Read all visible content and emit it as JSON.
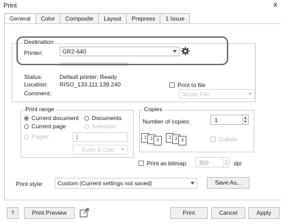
{
  "window": {
    "title": "Print",
    "close_glyph": "x"
  },
  "tabs": [
    {
      "label": "General",
      "active": true
    },
    {
      "label": "Color",
      "active": false
    },
    {
      "label": "Composite",
      "active": false
    },
    {
      "label": "Layout",
      "active": false
    },
    {
      "label": "Prepress",
      "active": false
    },
    {
      "label": "1 Issue",
      "active": false
    }
  ],
  "destination": {
    "label": "Destination",
    "printer_label": "Printer:",
    "printer_value": "GR2-640",
    "status_label": "Status:",
    "status_value": "Default printer; Ready",
    "location_label": "Location:",
    "location_value": "RISO_133.111.139.240",
    "comment_label": "Comment:",
    "print_to_file_label": "Print to file",
    "file_mode_value": "Single File",
    "settings_icon": "gear-icon"
  },
  "print_range": {
    "label": "Print range",
    "current_document": "Current document",
    "documents": "Documents",
    "current_page": "Current page",
    "selection": "Selection",
    "pages": "Pages:",
    "pages_value": "1",
    "pages_filter": "Even & Odd"
  },
  "copies": {
    "label": "Copies",
    "number_label": "Number of copies:",
    "number_value": "1",
    "collate_label": "Collate",
    "collate_pages": [
      "1",
      "2",
      "3",
      "1",
      "2",
      "3"
    ]
  },
  "bitmap": {
    "label": "Print as bitmap:",
    "value": "300",
    "unit": "dpi"
  },
  "print_style": {
    "label": "Print style:",
    "value": "Custom (Current settings not saved)",
    "save_as": "Save As..."
  },
  "footer": {
    "help": "?",
    "print_preview": "Print Preview",
    "preview_icon": "external-window-icon",
    "print": "Print",
    "cancel": "Cancel",
    "apply": "Apply"
  }
}
